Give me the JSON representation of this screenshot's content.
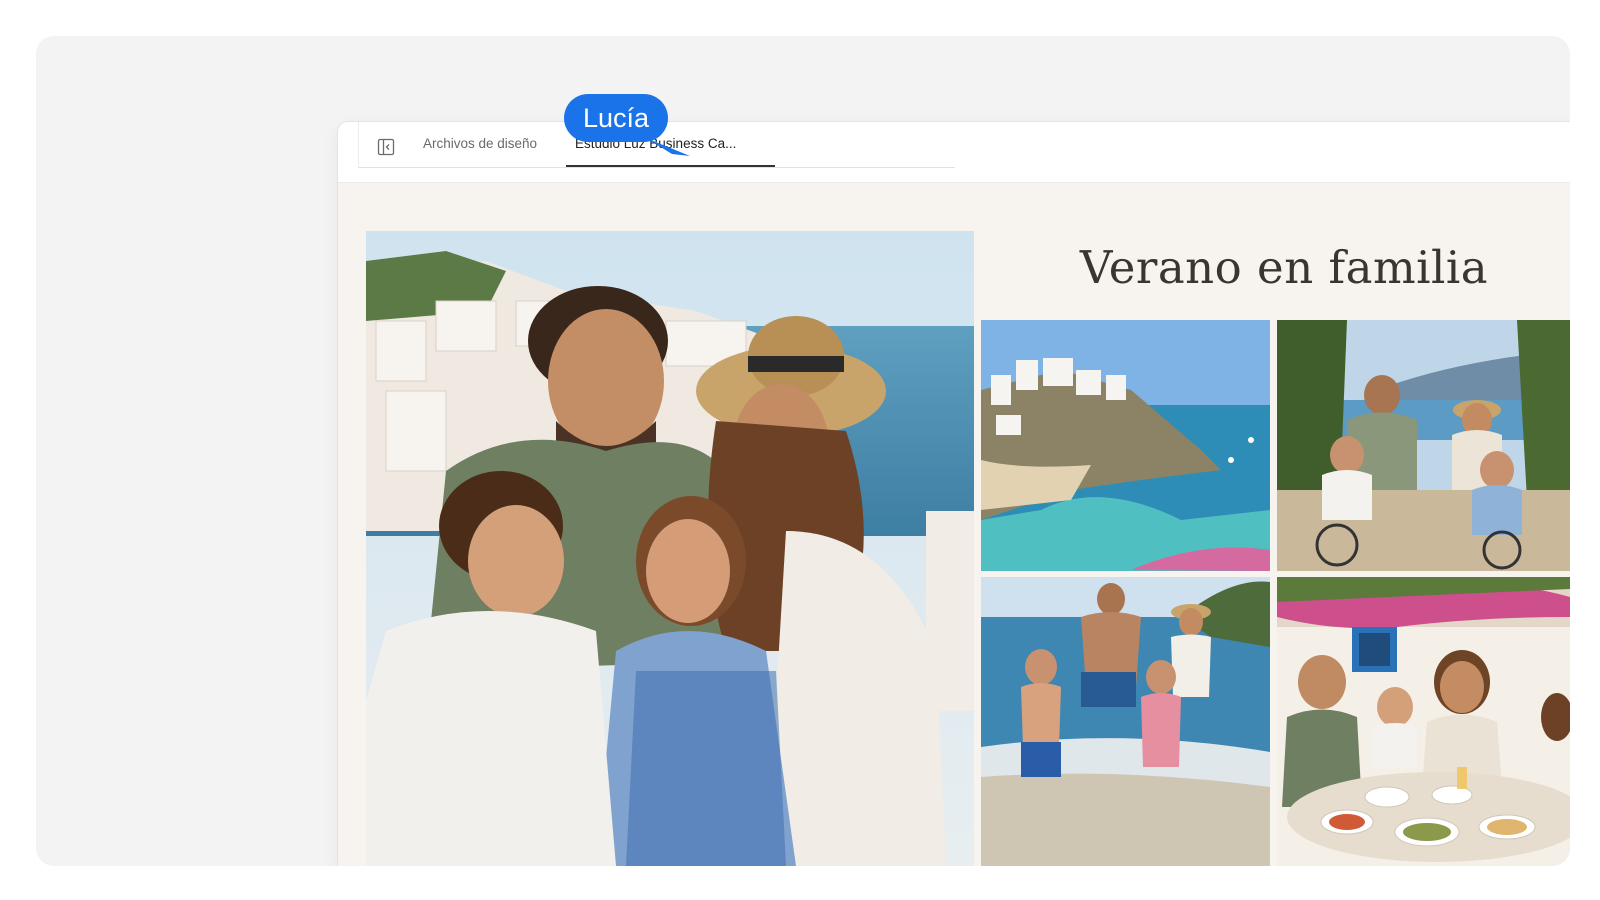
{
  "window": {
    "tabs": [
      {
        "label": "Archivos de diseño",
        "active": false
      },
      {
        "label": "Estudio Luz Business Ca...",
        "active": true
      }
    ]
  },
  "collaborator": {
    "name": "Lucía",
    "color": "#1a73e8"
  },
  "icons": {
    "sidebar_toggle": "sidebar-toggle-icon",
    "cursor": "cursor-pointer-icon"
  },
  "design": {
    "title": "Verano en familia",
    "photos": [
      {
        "name": "photo-family-portrait",
        "subject": "family portrait by the sea"
      },
      {
        "name": "photo-coastal-village",
        "subject": "coastal village and cove"
      },
      {
        "name": "photo-family-cycling",
        "subject": "family cycling"
      },
      {
        "name": "photo-beach-running",
        "subject": "family running at the beach"
      },
      {
        "name": "photo-family-meal",
        "subject": "family meal outdoors"
      }
    ]
  }
}
